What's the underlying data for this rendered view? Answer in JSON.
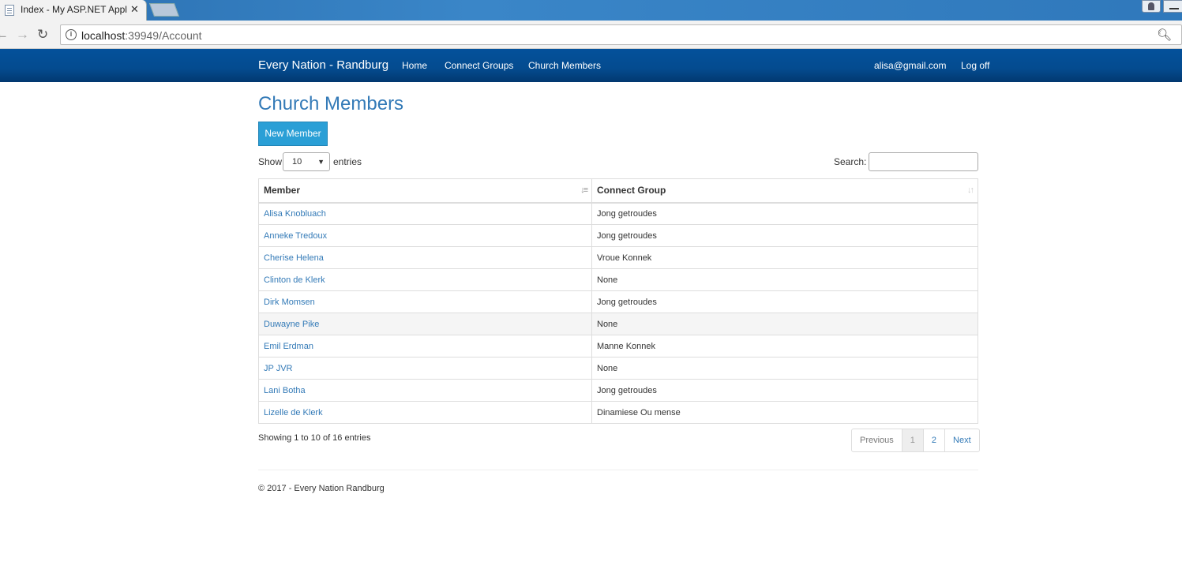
{
  "browser": {
    "tab_title": "Index - My ASP.NET Appl",
    "url_host": "localhost",
    "url_path": ":39949/Account"
  },
  "navbar": {
    "brand": "Every Nation - Randburg",
    "links": [
      "Home",
      "Connect Groups",
      "Church Members"
    ],
    "user": "alisa@gmail.com",
    "logoff": "Log off"
  },
  "page": {
    "title": "Church Members",
    "new_button": "New Member"
  },
  "table_controls": {
    "show_label": "Show",
    "page_length": "10",
    "entries_label": "entries",
    "search_label": "Search:"
  },
  "table": {
    "columns": [
      "Member",
      "Connect Group"
    ],
    "rows": [
      {
        "member": "Alisa Knobluach",
        "group": "Jong getroudes"
      },
      {
        "member": "Anneke Tredoux",
        "group": "Jong getroudes"
      },
      {
        "member": "Cherise Helena",
        "group": "Vroue Konnek"
      },
      {
        "member": "Clinton de Klerk",
        "group": "None"
      },
      {
        "member": "Dirk Momsen",
        "group": "Jong getroudes"
      },
      {
        "member": "Duwayne Pike",
        "group": "None"
      },
      {
        "member": "Emil Erdman",
        "group": "Manne Konnek"
      },
      {
        "member": "JP JVR",
        "group": "None"
      },
      {
        "member": "Lani Botha",
        "group": "Jong getroudes"
      },
      {
        "member": "Lizelle de Klerk",
        "group": "Dinamiese Ou mense"
      }
    ]
  },
  "pagination": {
    "info": "Showing 1 to 10 of 16 entries",
    "previous": "Previous",
    "pages": [
      "1",
      "2"
    ],
    "next": "Next"
  },
  "footer": {
    "text": "© 2017 - Every Nation Randburg"
  }
}
